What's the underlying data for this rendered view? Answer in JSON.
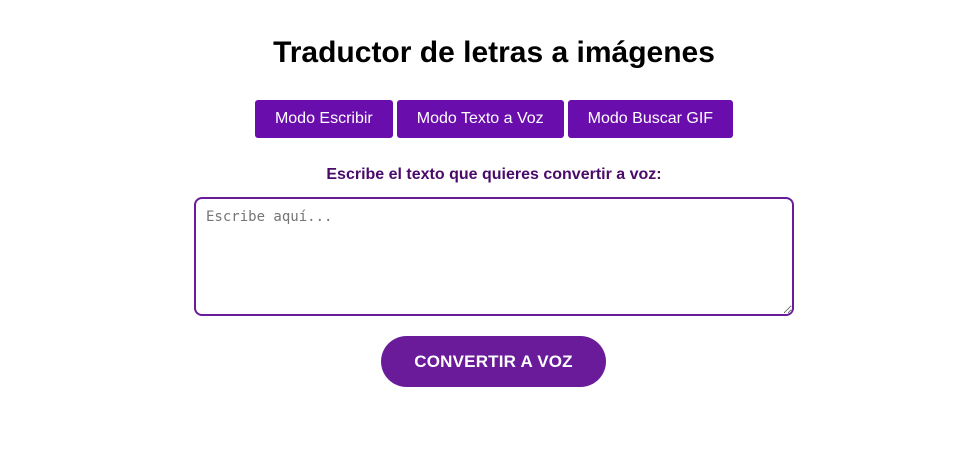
{
  "title": "Traductor de letras a imágenes",
  "modes": [
    {
      "label": "Modo Escribir"
    },
    {
      "label": "Modo Texto a Voz"
    },
    {
      "label": "Modo Buscar GIF"
    }
  ],
  "prompt": "Escribe el texto que quieres convertir a voz:",
  "input": {
    "value": "",
    "placeholder": "Escribe aquí..."
  },
  "convert_label": "CONVERTIR A VOZ",
  "colors": {
    "button": "#6a0dad",
    "convert_button": "#6a1b9a",
    "prompt_text": "#4a0a6a",
    "input_border": "#6a1b9a"
  }
}
